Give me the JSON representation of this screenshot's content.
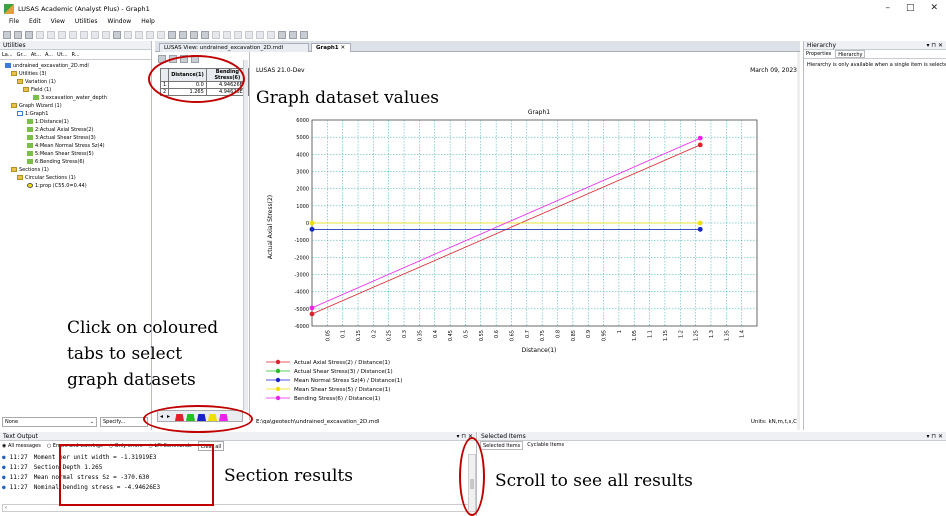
{
  "window": {
    "title": "LUSAS Academic (Analyst Plus) - Graph1",
    "min": "–",
    "max": "□",
    "close": "✕"
  },
  "menu": [
    "File",
    "Edit",
    "View",
    "Utilities",
    "Window",
    "Help"
  ],
  "utilities": {
    "header": "Utilities",
    "tabs": [
      "La...",
      "Gr...",
      "At...",
      "A...",
      "Ut...",
      "R..."
    ],
    "tree": [
      "undrained_excavation_2D.mdl",
      "Utilities (3)",
      "Variation (1)",
      "Field (1)",
      "3:excavation_water_depth",
      "Graph Wizard (1)",
      "1:Graph1",
      "1:Distance(1)",
      "2:Actual Axial Stress(2)",
      "3:Actual Shear Stress(3)",
      "4:Mean Normal Stress Sz(4)",
      "5:Mean Shear Stress(5)",
      "6:Bending Stress(6)",
      "Sections (1)",
      "Circular Sections (1)",
      "1:prop (C55.0=0.44)"
    ],
    "filter": "None",
    "specify": "Specify..."
  },
  "doc_tabs": [
    "LUSAS View: undrained_excavation_2D.mdl Window 1",
    "Graph1"
  ],
  "table": {
    "headers": [
      "Distance(1)",
      "Bending Stress(6)"
    ],
    "rows": [
      [
        "1",
        "0.0",
        "4.94626E3"
      ],
      [
        "2",
        "1.265",
        "4.94626E3"
      ]
    ]
  },
  "graph": {
    "version": "LUSAS 21.0-Dev",
    "date": "March 09, 2023",
    "footer_file": "E:\\qa\\geotech\\undrained_excavation_2D.mdl",
    "units": "Units: kN,m,t,s,C"
  },
  "chart_data": {
    "type": "line",
    "title": "Graph1",
    "xlabel": "Distance(1)",
    "ylabel": "Actual Axial Stress(2)",
    "xlim": [
      0,
      1.45
    ],
    "ylim": [
      -6000,
      6000
    ],
    "xticks": [
      "0.05",
      "0.1",
      "0.15",
      "0.2",
      "0.25",
      "0.3",
      "0.35",
      "0.4",
      "0.45",
      "0.5",
      "0.55",
      "0.6",
      "0.65",
      "0.7",
      "0.75",
      "0.8",
      "0.85",
      "0.9",
      "0.95",
      "1",
      "1.05",
      "1.1",
      "1.15",
      "1.2",
      "1.25",
      "1.3",
      "1.35",
      "1.4"
    ],
    "yticks": [
      "6000",
      "5000",
      "4000",
      "3000",
      "2000",
      "1000",
      "0",
      "-1000",
      "-2000",
      "-3000",
      "-4000",
      "-5000",
      "-6000"
    ],
    "grid": true,
    "legend": "bottom-left",
    "x": [
      0.0,
      1.265
    ],
    "series": [
      {
        "name": "Actual Axial Stress(2) / Distance(1)",
        "color": "#e0202a",
        "values": [
          -5300,
          4550
        ]
      },
      {
        "name": "Actual Shear Stress(3) / Distance(1)",
        "color": "#22c022",
        "values": [
          -370.63,
          -370.63
        ]
      },
      {
        "name": "Mean Normal Stress Sz(4) / Distance(1)",
        "color": "#1a22cc",
        "values": [
          -370.63,
          -370.63
        ]
      },
      {
        "name": "Mean Shear Stress(5) / Distance(1)",
        "color": "#f0e000",
        "values": [
          0,
          0
        ]
      },
      {
        "name": "Bending Stress(6) / Distance(1)",
        "color": "#f020f0",
        "values": [
          -4946.26,
          4946.26
        ]
      }
    ]
  },
  "hierarchy": {
    "header": "Hierarchy",
    "tabs": [
      "Properties",
      "Hierarchy"
    ],
    "message": "Hierarchy is only available when a single item is selectec"
  },
  "text_output": {
    "header": "Text Output",
    "filters": [
      "All messages",
      "Errors and warnings",
      "Only errors",
      "LPI Commands"
    ],
    "clear": "Clear all",
    "lines": [
      {
        "time": "11:27",
        "text": "Moment per unit width = -1.31919E3"
      },
      {
        "time": "11:27",
        "text": "Section Depth 1.265"
      },
      {
        "time": "11:27",
        "text": "Mean normal stress Sz = -370.630"
      },
      {
        "time": "11:27",
        "text": "Nominal bending stress = -4.94626E3"
      }
    ]
  },
  "selected_items": {
    "header": "Selected Items",
    "tabs": [
      "Selected Items",
      "Cyclable Items"
    ]
  },
  "annotations": {
    "dataset_values": "Graph dataset values",
    "click_tabs_1": "Click on coloured",
    "click_tabs_2": "tabs to select",
    "click_tabs_3": "graph datasets",
    "section_results": "Section results",
    "scroll": "Scroll to see all results"
  },
  "colors": {
    "annotation_red": "#c00000"
  }
}
